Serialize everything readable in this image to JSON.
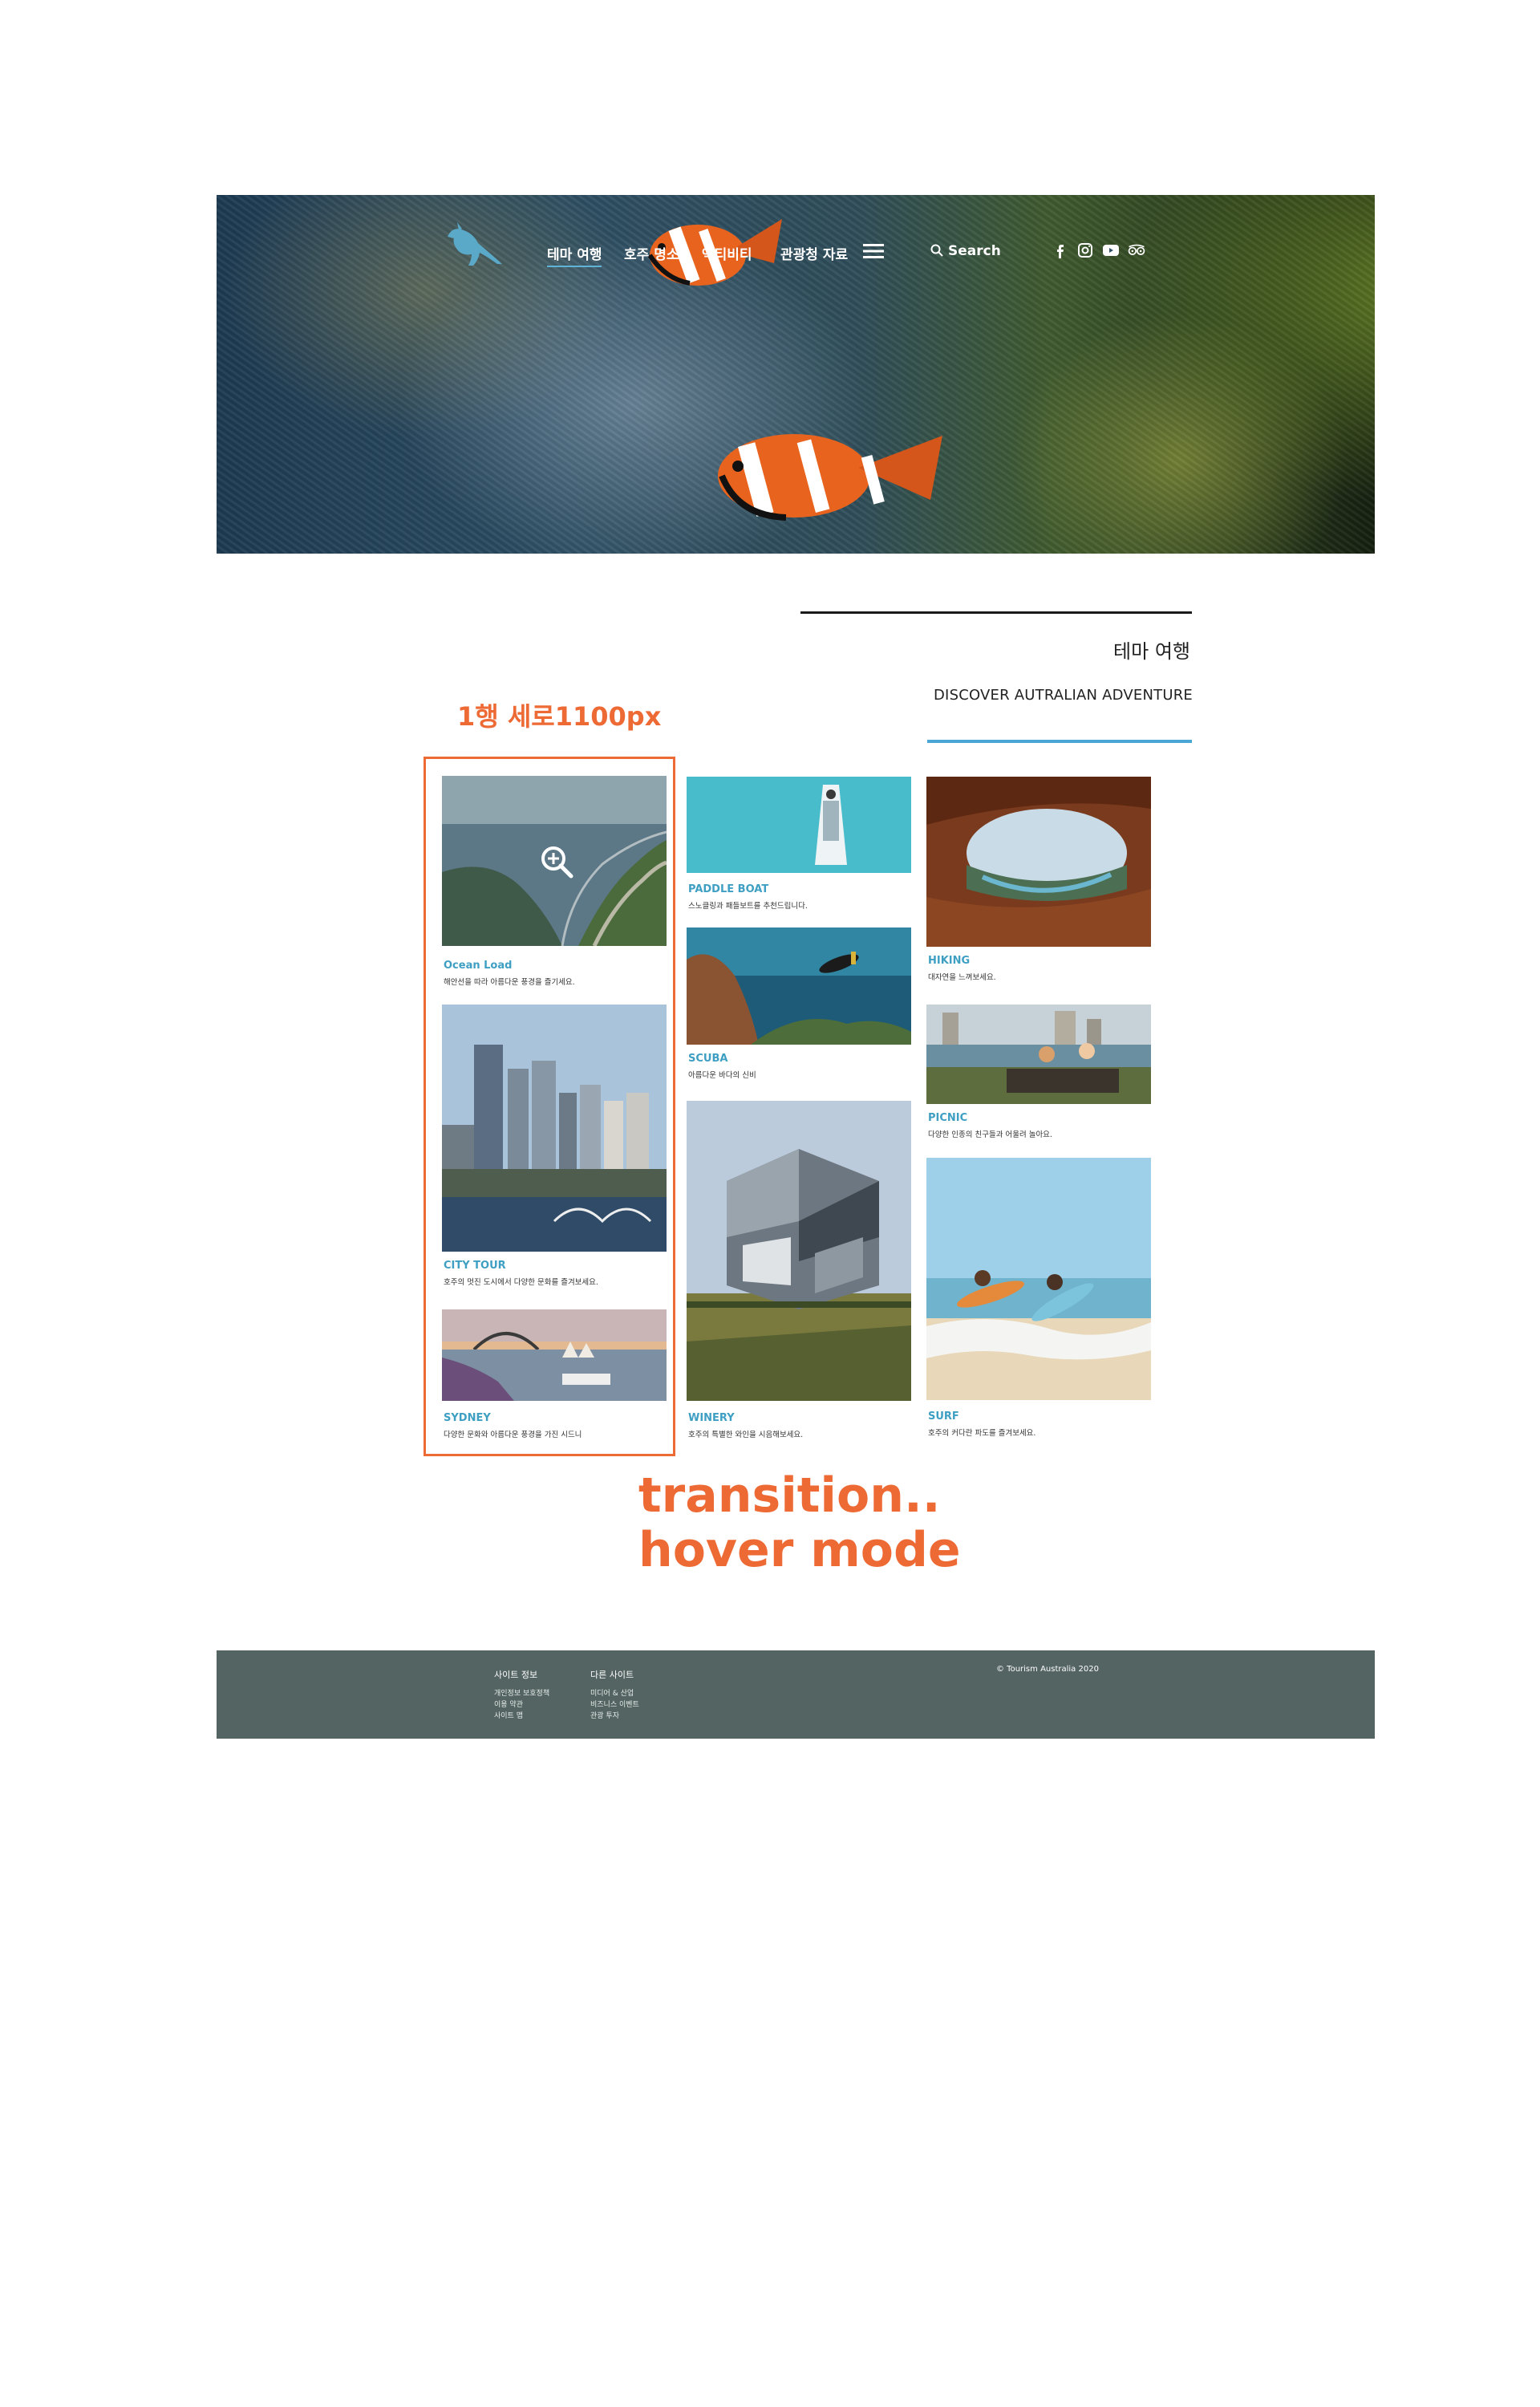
{
  "header": {
    "nav": [
      "테마 여행",
      "호주 명소",
      "액티비티",
      "관광청 자료"
    ],
    "active_index": 0,
    "search_label": "Search",
    "social_icons": [
      "facebook-icon",
      "instagram-icon",
      "youtube-icon",
      "tripadvisor-icon"
    ]
  },
  "section": {
    "title": "테마 여행",
    "subtitle": "DISCOVER AUTRALIAN ADVENTURE"
  },
  "annotations": {
    "row_height": "1행 세로1100px",
    "hover_note": "transition..\nhover mode"
  },
  "gallery": {
    "columns": [
      [
        {
          "title": "Ocean Load",
          "desc": "해안선을 따라 아름다운 풍경을 즐기세요."
        },
        {
          "title": "CITY TOUR",
          "desc": "호주의 멋진 도시에서 다양한 문화를 즐겨보세요."
        },
        {
          "title": "SYDNEY",
          "desc": "다양한 문화와 아름다운 풍경을 가진 시드니"
        }
      ],
      [
        {
          "title": "PADDLE BOAT",
          "desc": "스노클링과 패들보트를 추천드립니다."
        },
        {
          "title": "SCUBA",
          "desc": "아름다운 바다의 신비"
        },
        {
          "title": "WINERY",
          "desc": "호주의 특별한 와인을 시음해보세요."
        }
      ],
      [
        {
          "title": "HIKING",
          "desc": "대자연을 느껴보세요."
        },
        {
          "title": "PICNIC",
          "desc": "다양한 인종의 친구들과 어울려 놀아요."
        },
        {
          "title": "SURF",
          "desc": "호주의 커다란 파도를 즐겨보세요."
        }
      ]
    ]
  },
  "footer": {
    "site_info": {
      "heading": "사이트 정보",
      "links": [
        "개인정보 보호정책",
        "이용 약관",
        "사이트 맵"
      ]
    },
    "other_sites": {
      "heading": "다른 사이트",
      "links": [
        "미디어 & 산업",
        "비즈니스 이벤트",
        "관광 투자"
      ]
    },
    "copyright": "© Tourism Australia 2020"
  },
  "colors": {
    "accent_blue": "#3e9fc3",
    "annotation_orange": "#ee6a35",
    "footer_bg": "#536462"
  }
}
